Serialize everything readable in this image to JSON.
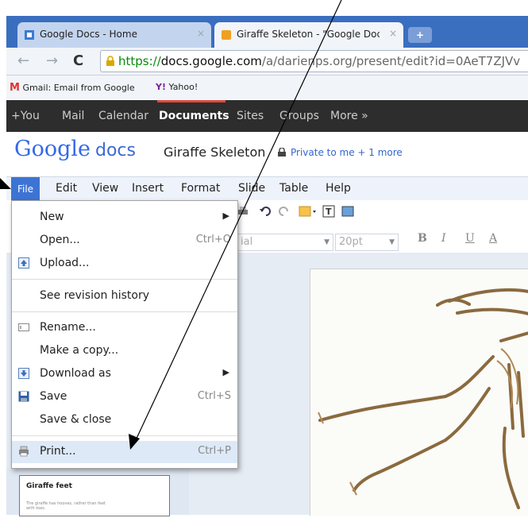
{
  "browser": {
    "tabs": [
      {
        "label": "Google Docs - Home",
        "close": "×"
      },
      {
        "label": "Giraffe Skeleton - \"Google Doc",
        "close": "×"
      }
    ],
    "new_tab": "+",
    "nav": {
      "back": "←",
      "forward": "→",
      "reload": "C"
    },
    "url": {
      "scheme": "https://",
      "host": "docs.google.com",
      "path": "/a/darienps.org/present/edit?id=0AeT7ZJVv"
    },
    "bookmarks": [
      {
        "label": "Gmail: Email from Google"
      },
      {
        "label": "Yahoo!"
      }
    ]
  },
  "google_bar": {
    "items": [
      "+You",
      "Mail",
      "Calendar",
      "Documents",
      "Sites",
      "Groups",
      "More »"
    ],
    "active": "Documents"
  },
  "docs": {
    "logo": "Google",
    "logo_suffix": "docs",
    "title": "Giraffe Skeleton",
    "privacy": "Private to me + 1 more"
  },
  "menubar": [
    "File",
    "Edit",
    "View",
    "Insert",
    "Format",
    "Slide",
    "Table",
    "Help"
  ],
  "toolbar": {
    "font": "ial",
    "size": "20pt",
    "format": [
      "B",
      "I",
      "U",
      "A"
    ]
  },
  "file_menu": [
    {
      "label": "New",
      "shortcut": "",
      "submenu": true,
      "icon": ""
    },
    {
      "label": "Open...",
      "shortcut": "Ctrl+O",
      "submenu": false,
      "icon": ""
    },
    {
      "label": "Upload...",
      "shortcut": "",
      "submenu": false,
      "icon": "upload-icon"
    },
    {
      "label": "See revision history",
      "shortcut": "",
      "submenu": false,
      "icon": ""
    },
    {
      "label": "Rename...",
      "shortcut": "",
      "submenu": false,
      "icon": "rename-icon"
    },
    {
      "label": "Make a copy...",
      "shortcut": "",
      "submenu": false,
      "icon": ""
    },
    {
      "label": "Download as",
      "shortcut": "",
      "submenu": true,
      "icon": "download-icon"
    },
    {
      "label": "Save",
      "shortcut": "Ctrl+S",
      "submenu": false,
      "icon": "save-icon"
    },
    {
      "label": "Save & close",
      "shortcut": "",
      "submenu": false,
      "icon": ""
    },
    {
      "label": "Print...",
      "shortcut": "Ctrl+P",
      "submenu": false,
      "icon": "print-icon"
    }
  ],
  "thumbnail": {
    "title": "Giraffe feet",
    "body": "The giraffe has hooves, rather than feet with toes."
  },
  "colors": {
    "accent": "#3d74d4",
    "tab_bar": "#3a6ebf",
    "gbar": "#2d2d2d",
    "highlight": "#dd4b39"
  }
}
